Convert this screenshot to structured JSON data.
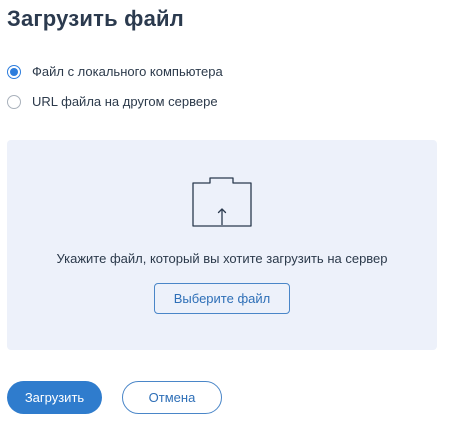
{
  "page": {
    "title": "Загрузить файл"
  },
  "source_options": [
    {
      "label": "Файл с локального компьютера",
      "selected": true
    },
    {
      "label": "URL файла на другом сервере",
      "selected": false
    }
  ],
  "dropzone": {
    "icon": "folder-upload-icon",
    "instruction": "Укажите файл, который вы хотите загрузить на сервер",
    "choose_label": "Выберите файл"
  },
  "actions": {
    "upload_label": "Загрузить",
    "cancel_label": "Отмена"
  },
  "colors": {
    "accent": "#2f7ccd",
    "dropzone_bg": "#edf1fa",
    "title": "#2b3a4e"
  }
}
